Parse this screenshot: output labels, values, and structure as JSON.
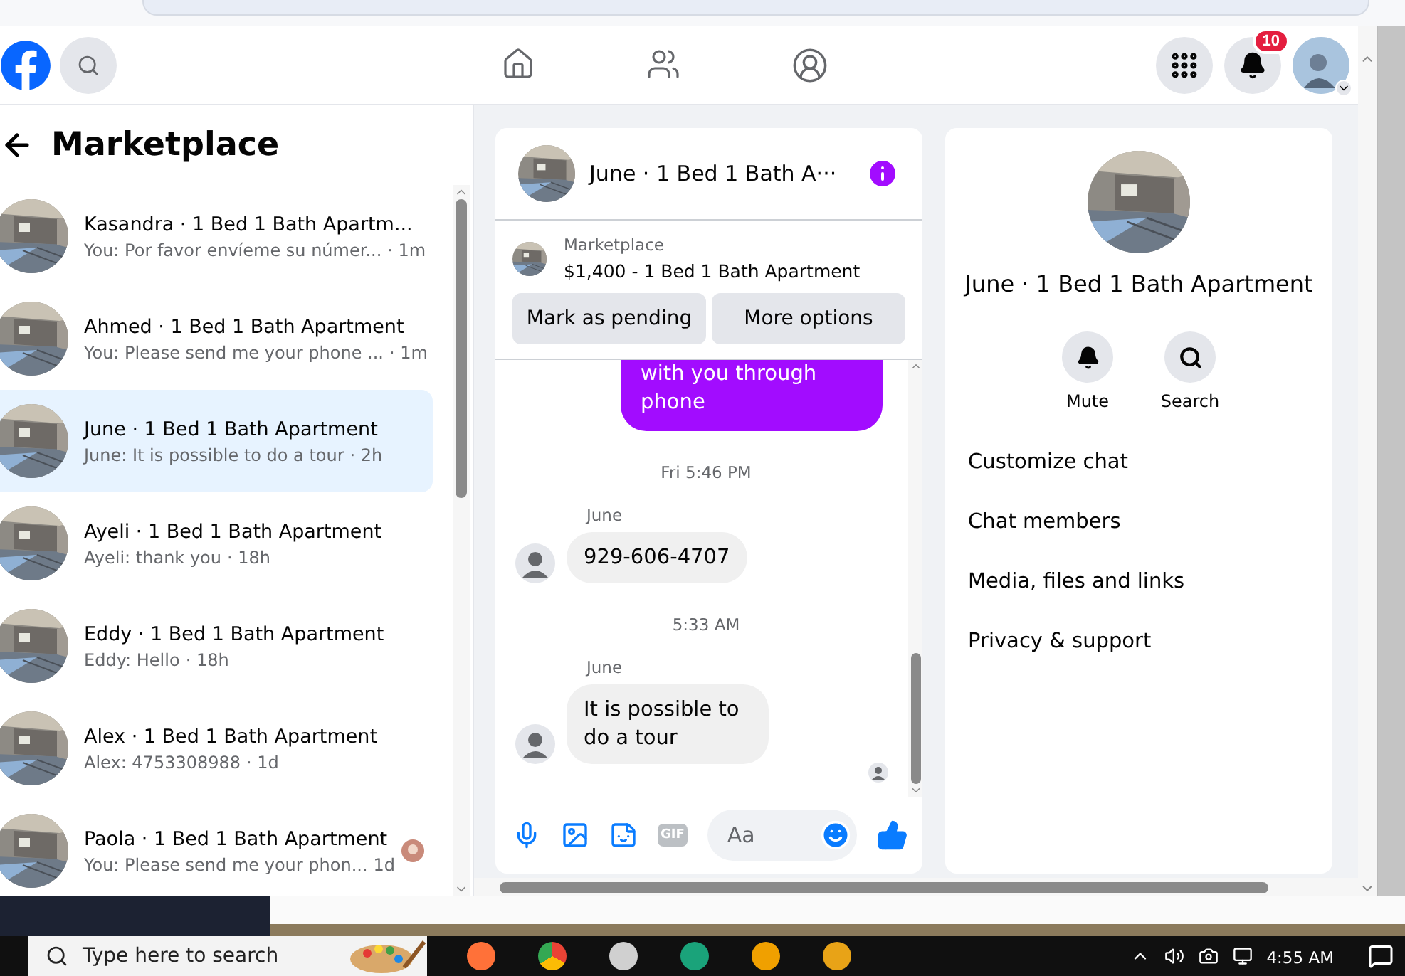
{
  "header": {
    "notification_badge": "10"
  },
  "sidebar": {
    "title": "Marketplace",
    "conversations": [
      {
        "name": "Kasandra · 1 Bed 1 Bath Apartm...",
        "preview": "You: Por favor envíeme su númer...",
        "time": "· 1m",
        "selected": false,
        "seen": false
      },
      {
        "name": "Ahmed · 1 Bed 1 Bath Apartment",
        "preview": "You: Please send me your phone ...",
        "time": "· 1m",
        "selected": false,
        "seen": false
      },
      {
        "name": "June · 1 Bed 1 Bath Apartment",
        "preview": "June: It is possible to do a tour",
        "time": "· 2h",
        "selected": true,
        "seen": false
      },
      {
        "name": "Ayeli · 1 Bed 1 Bath Apartment",
        "preview": "Ayeli: thank you",
        "time": "· 18h",
        "selected": false,
        "seen": false
      },
      {
        "name": "Eddy · 1 Bed 1 Bath Apartment",
        "preview": "Eddy: Hello",
        "time": "· 18h",
        "selected": false,
        "seen": false
      },
      {
        "name": "Alex · 1 Bed 1 Bath Apartment",
        "preview": "Alex: 4753308988",
        "time": "· 1d",
        "selected": false,
        "seen": false
      },
      {
        "name": "Paola · 1 Bed 1 Bath Apartment",
        "preview": "You: Please send me your phon...",
        "time": "1d",
        "selected": false,
        "seen": true
      }
    ]
  },
  "chat": {
    "title": "June · 1 Bed 1 Bath A···",
    "listing": {
      "source": "Marketplace",
      "summary": "$1,400 - 1 Bed 1 Bath Apartment"
    },
    "actions": [
      "Mark as pending",
      "More options"
    ],
    "messages": [
      {
        "kind": "outgoing",
        "text": "with you through phone"
      },
      {
        "kind": "timestamp",
        "text": "Fri 5:46 PM"
      },
      {
        "kind": "incoming",
        "sender": "June",
        "text": "929-606-4707"
      },
      {
        "kind": "timestamp",
        "text": "5:33 AM"
      },
      {
        "kind": "incoming",
        "sender": "June",
        "text": "It is possible to do a tour"
      }
    ],
    "composer": {
      "gif_label": "GIF",
      "placeholder": "Aa"
    }
  },
  "details": {
    "name": "June · 1 Bed 1 Bath Apartment",
    "actions": [
      {
        "kind": "mute",
        "label": "Mute"
      },
      {
        "kind": "search",
        "label": "Search"
      }
    ],
    "menu": [
      "Customize chat",
      "Chat members",
      "Media, files and links",
      "Privacy & support"
    ]
  },
  "taskbar": {
    "search_placeholder": "Type here to search",
    "time": "4:55 AM"
  }
}
